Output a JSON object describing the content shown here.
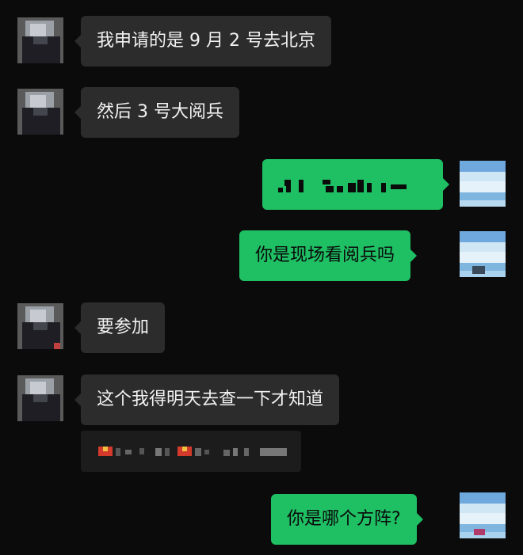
{
  "messages": [
    {
      "side": "in",
      "text": "我申请的是 9 月 2 号去北京"
    },
    {
      "side": "in",
      "text": "然后 3 号大阅兵"
    },
    {
      "side": "out",
      "text": ""
    },
    {
      "side": "out",
      "text": "你是现场看阅兵吗"
    },
    {
      "side": "in",
      "text": "要参加"
    },
    {
      "side": "in",
      "text": "这个我得明天去查一下才知道"
    },
    {
      "side": "in",
      "text": ""
    },
    {
      "side": "out",
      "text": "你是哪个方阵?"
    }
  ],
  "colors": {
    "background": "#0b0b0b",
    "incoming_bubble": "#2c2c2c",
    "outgoing_bubble": "#1fbf64"
  },
  "icons": {
    "incoming_avatar": "pixelated-person-avatar",
    "outgoing_avatar": "pixelated-sky-avatar"
  }
}
